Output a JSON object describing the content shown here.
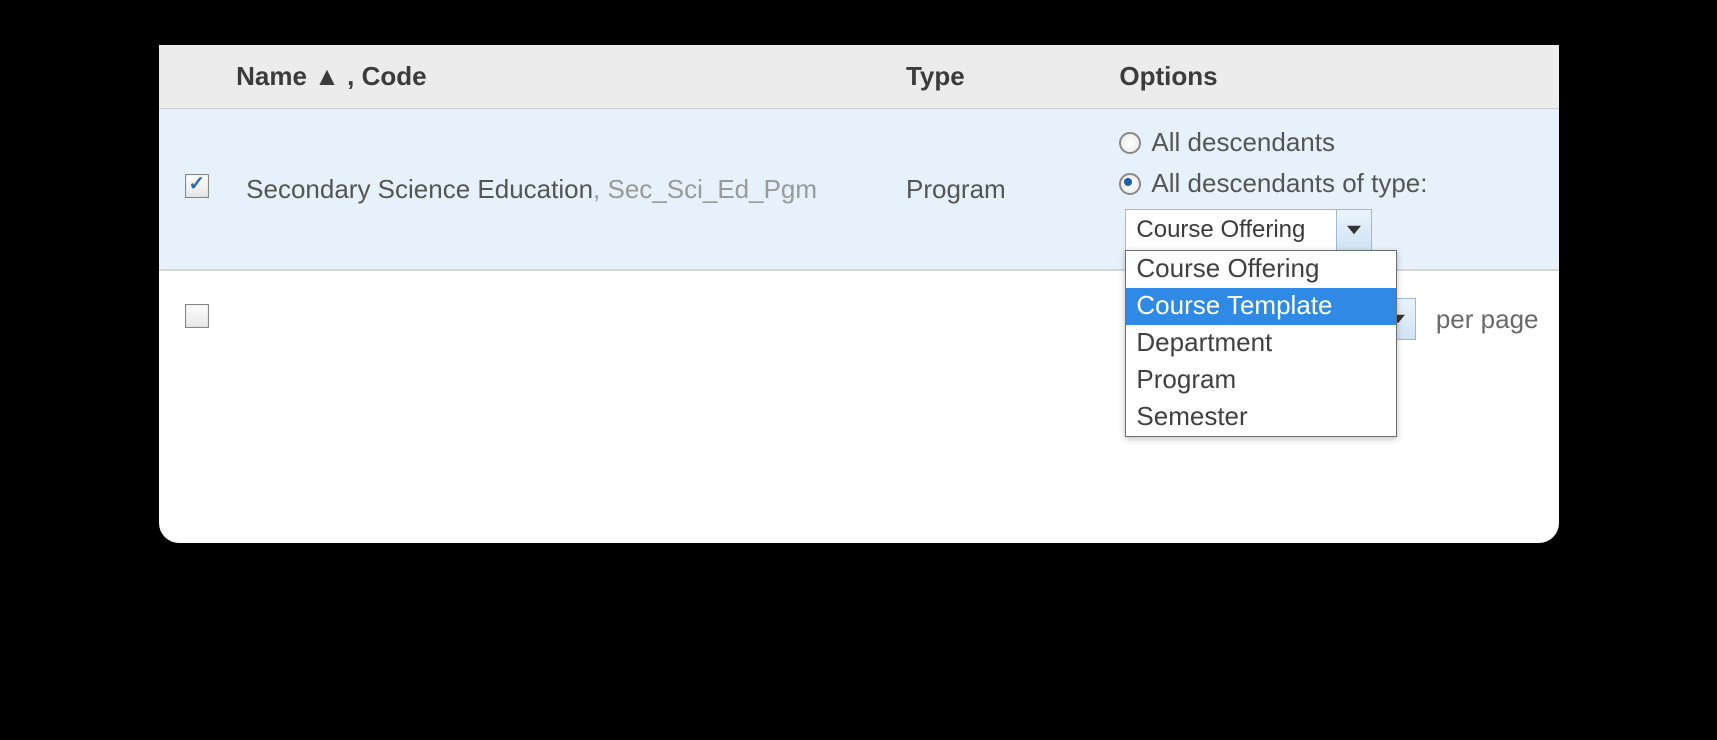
{
  "columns": {
    "name_code": "Name ▲ , Code",
    "type": "Type",
    "options": "Options"
  },
  "row": {
    "checked": true,
    "name": "Secondary Science Education",
    "sep": ", ",
    "code": "Sec_Sci_Ed_Pgm",
    "type": "Program"
  },
  "options": {
    "all_descendants": "All descendants",
    "all_descendants_of_type": "All descendants of type:",
    "selected_type": "Course Offering"
  },
  "dropdown": {
    "items": [
      "Course Offering",
      "Course Template",
      "Department",
      "Program",
      "Semester"
    ],
    "highlight_index": 1
  },
  "footer": {
    "per_page": "per page"
  }
}
